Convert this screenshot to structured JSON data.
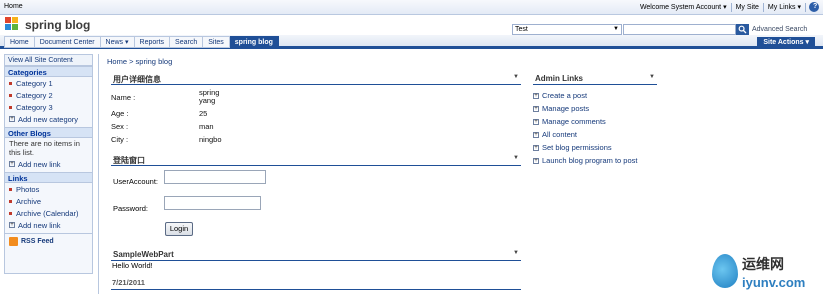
{
  "topbar": {
    "home": "Home",
    "welcome": "Welcome System Account ▾",
    "my_site": "My Site",
    "my_links": "My Links ▾",
    "help": "?"
  },
  "header": {
    "site_title": "spring blog",
    "search_scope": "Test",
    "search_query": "",
    "advanced_search": "Advanced Search"
  },
  "nav": {
    "tabs": [
      "Home",
      "Document Center",
      "News ▾",
      "Reports",
      "Search",
      "Sites",
      "spring blog"
    ],
    "active_tab": "spring blog",
    "site_actions": "Site Actions ▾"
  },
  "leftnav": {
    "view_all": "View All Site Content",
    "categories_head": "Categories",
    "categories": [
      "Category 1",
      "Category 2",
      "Category 3"
    ],
    "add_category": "Add new category",
    "other_blogs_head": "Other Blogs",
    "other_blogs_empty": "There are no items in this list.",
    "add_link_1": "Add new link",
    "links_head": "Links",
    "links": [
      "Photos",
      "Archive",
      "Archive (Calendar)"
    ],
    "add_link_2": "Add new link",
    "rss": "RSS Feed"
  },
  "breadcrumb": "Home > spring blog",
  "user_info": {
    "title": "用户详细信息",
    "name_label": "Name :",
    "name_value_1": "spring",
    "name_value_2": "yang",
    "age_label": "Age :",
    "age_value": "25",
    "sex_label": "Sex :",
    "sex_value": "man",
    "city_label": "City :",
    "city_value": "ningbo"
  },
  "login": {
    "title": "登陆窗口",
    "user_label": "UserAccount:",
    "password_label": "Password:",
    "button": "Login"
  },
  "sample": {
    "title": "SampleWebPart",
    "text": "Hello World!",
    "date": "7/21/2011"
  },
  "admin": {
    "title": "Admin Links",
    "links": [
      "Create a post",
      "Manage posts",
      "Manage comments",
      "All content",
      "Set blog permissions",
      "Launch blog program to post"
    ]
  },
  "watermark": {
    "cn": "运维网",
    "en": "iyunv.com"
  },
  "colors": {
    "accent": "#1f4f97",
    "link": "#15397a"
  }
}
